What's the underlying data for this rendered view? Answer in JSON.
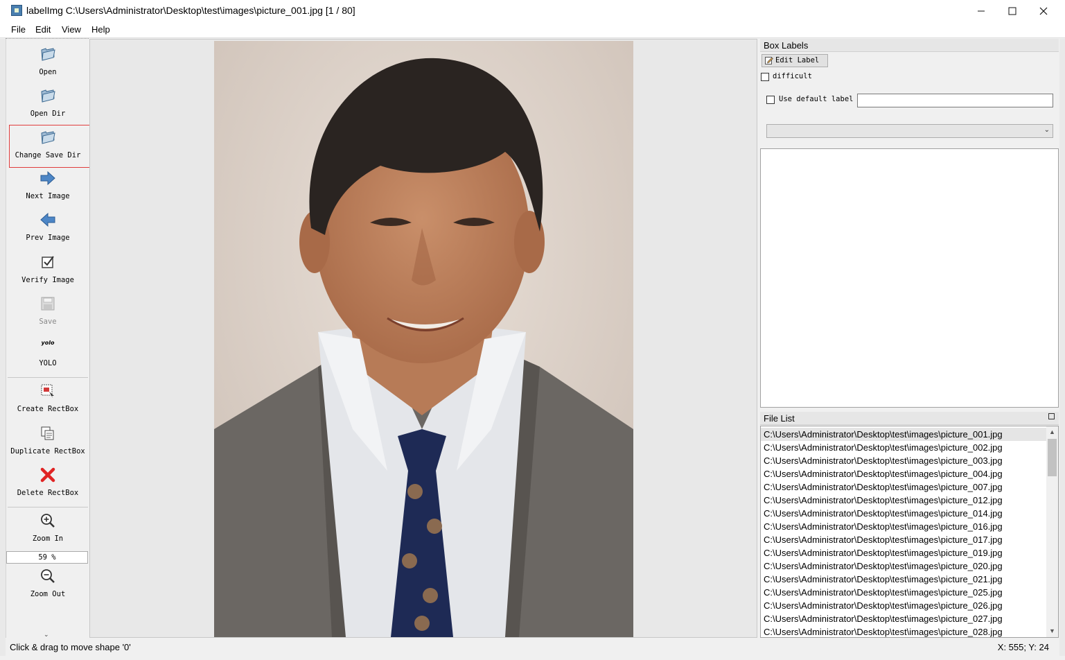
{
  "window": {
    "title": "labelImg C:\\Users\\Administrator\\Desktop\\test\\images\\picture_001.jpg [1 / 80]",
    "minimize_icon": "minimize-icon",
    "maximize_icon": "maximize-icon",
    "close_icon": "close-icon"
  },
  "menu": {
    "file": "File",
    "edit": "Edit",
    "view": "View",
    "help": "Help"
  },
  "toolbar": {
    "open": "Open",
    "open_dir": "Open Dir",
    "change_save_dir": "Change Save Dir",
    "next_image": "Next Image",
    "prev_image": "Prev Image",
    "verify_image": "Verify Image",
    "save": "Save",
    "format_icon_text": "yolo",
    "format": "YOLO",
    "create_rectbox": "Create RectBox",
    "duplicate_rectbox": "Duplicate RectBox",
    "delete_rectbox": "Delete RectBox",
    "zoom_in": "Zoom In",
    "zoom_value": "59 %",
    "zoom_out": "Zoom Out"
  },
  "box_labels": {
    "title": "Box Labels",
    "edit_label": "Edit Label",
    "difficult": "difficult",
    "use_default_label": "Use default label",
    "default_label_value": ""
  },
  "file_list": {
    "title": "File List",
    "selected_index": 0,
    "items": [
      "C:\\Users\\Administrator\\Desktop\\test\\images\\picture_001.jpg",
      "C:\\Users\\Administrator\\Desktop\\test\\images\\picture_002.jpg",
      "C:\\Users\\Administrator\\Desktop\\test\\images\\picture_003.jpg",
      "C:\\Users\\Administrator\\Desktop\\test\\images\\picture_004.jpg",
      "C:\\Users\\Administrator\\Desktop\\test\\images\\picture_007.jpg",
      "C:\\Users\\Administrator\\Desktop\\test\\images\\picture_012.jpg",
      "C:\\Users\\Administrator\\Desktop\\test\\images\\picture_014.jpg",
      "C:\\Users\\Administrator\\Desktop\\test\\images\\picture_016.jpg",
      "C:\\Users\\Administrator\\Desktop\\test\\images\\picture_017.jpg",
      "C:\\Users\\Administrator\\Desktop\\test\\images\\picture_019.jpg",
      "C:\\Users\\Administrator\\Desktop\\test\\images\\picture_020.jpg",
      "C:\\Users\\Administrator\\Desktop\\test\\images\\picture_021.jpg",
      "C:\\Users\\Administrator\\Desktop\\test\\images\\picture_025.jpg",
      "C:\\Users\\Administrator\\Desktop\\test\\images\\picture_026.jpg",
      "C:\\Users\\Administrator\\Desktop\\test\\images\\picture_027.jpg",
      "C:\\Users\\Administrator\\Desktop\\test\\images\\picture_028.jpg"
    ]
  },
  "status": {
    "message": "Click & drag to move shape '0'",
    "coords": "X: 555; Y: 24"
  },
  "colors": {
    "highlight": "#e03c3c",
    "selection": "#e5e5e5",
    "accent": "#4a7fb0"
  }
}
